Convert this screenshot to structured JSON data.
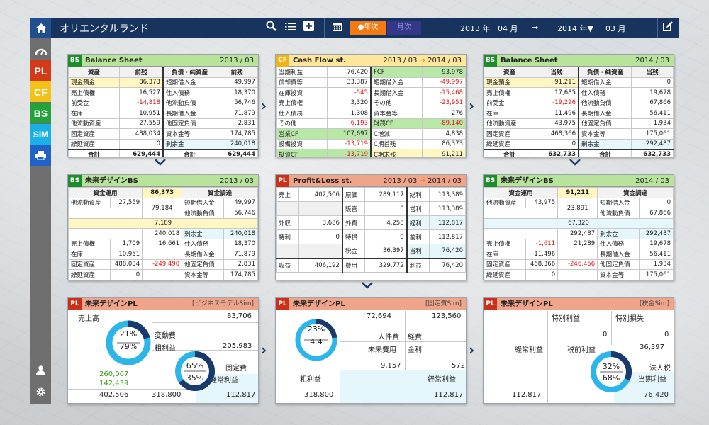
{
  "app": {
    "title": "オリエンタルランド"
  },
  "period": {
    "active": "●年次",
    "inactive": "月次",
    "from_year": "2013 年",
    "from_month": "04 月",
    "arrow": "→",
    "to_year": "2014 年▼",
    "to_month": "03 月"
  },
  "sidebar": {
    "pl": "PL",
    "cf": "CF",
    "bs": "BS",
    "sim": "SIM"
  },
  "colors": {
    "navy": "#17345e",
    "orange": "#f47a12",
    "pl": "#d23a1a",
    "cf": "#f3c21a",
    "bs": "#22a23a",
    "sim": "#1ab0e6",
    "donut_light": "#2cb5e8",
    "donut_dark": "#1a3a6b",
    "negative": "#e01414"
  },
  "bs1": {
    "tag": "BS",
    "title": "Balance Sheet",
    "date": "2013 / 03",
    "headers": [
      "資産",
      "前残",
      "負債・純資産",
      "前残"
    ],
    "rows": [
      [
        "現金預金",
        "86,373",
        "短期借入金",
        "49,997"
      ],
      [
        "売上債権",
        "16,527",
        "仕入債務",
        "18,370"
      ],
      [
        "前受金",
        "-14,818",
        "他流動負債",
        "56,746"
      ],
      [
        "在庫",
        "10,951",
        "長期借入金",
        "71,879"
      ],
      [
        "他流動資産",
        "27,559",
        "他固定負債",
        "2,831"
      ],
      [
        "固定資産",
        "488,034",
        "資本金等",
        "174,785"
      ],
      [
        "繰延資産",
        "0",
        "剰余金",
        "240,018"
      ]
    ],
    "total": [
      "合計",
      "629,444",
      "合計",
      "629,444"
    ]
  },
  "cf": {
    "tag": "CF",
    "title": "Cash Flow st.",
    "date_from": "2013 / 03",
    "date_to": "2014 / 03",
    "arrow": "→",
    "rows": [
      [
        "当期利益",
        "76,420",
        "FCF",
        "93,978"
      ],
      [
        "償却費等",
        "33,387",
        "短期借入金",
        "-49,997"
      ],
      [
        "在庫投資",
        "-545",
        "長期借入金",
        "-15,468"
      ],
      [
        "売上債権",
        "3,320",
        "その他",
        "-23,951"
      ],
      [
        "仕入債務",
        "1,308",
        "資本金等",
        "276"
      ],
      [
        "その他",
        "-6,193",
        "財務CF",
        "-89,140"
      ],
      [
        "営業CF",
        "107,697",
        "C増減",
        "4,838"
      ],
      [
        "設備投資",
        "-13,719",
        "C期首残",
        "86,373"
      ],
      [
        "投資CF",
        "-13,719",
        "C期末残",
        "91,211"
      ]
    ]
  },
  "bs2": {
    "tag": "BS",
    "title": "Balance Sheet",
    "date": "2014 / 03",
    "headers": [
      "資産",
      "当残",
      "負債・純資産",
      "当残"
    ],
    "rows": [
      [
        "現金預金",
        "91,211",
        "短期借入金",
        "0"
      ],
      [
        "売上債権",
        "17,685",
        "仕入債務",
        "19,678"
      ],
      [
        "前受金",
        "-19,296",
        "他流動負債",
        "67,866"
      ],
      [
        "在庫",
        "11,496",
        "長期借入金",
        "56,411"
      ],
      [
        "他流動資産",
        "43,975",
        "他固定負債",
        "1,934"
      ],
      [
        "固定資産",
        "468,366",
        "資本金等",
        "175,061"
      ],
      [
        "繰延資産",
        "0",
        "剰余金",
        "292,487"
      ]
    ],
    "total": [
      "合計",
      "632,733",
      "合計",
      "632,733"
    ]
  },
  "fbs1": {
    "tag": "BS",
    "title": "未来デザインBS",
    "date": "2013 / 03",
    "h1": "資金運用",
    "h2": "86,373",
    "h3": "資金調達",
    "r1": [
      "他流動資産",
      "27,559",
      "79,184",
      "短期借入金",
      "49,997"
    ],
    "r2": [
      "他流動負債",
      "56,746"
    ],
    "mid": "7,189",
    "r3": [
      "240,018",
      "剰余金",
      "240,018"
    ],
    "rows": [
      [
        "売上債権",
        "1,709",
        "16,661",
        "仕入債務",
        "18,370"
      ],
      [
        "在庫",
        "10,951",
        "",
        "長期借入金",
        "71,879"
      ],
      [
        "固定資産",
        "488,034",
        "-249,490",
        "他固定負債",
        "2,831"
      ],
      [
        "繰延資産",
        "0",
        "",
        "資本金等",
        "174,785"
      ]
    ]
  },
  "plst": {
    "tag": "PL",
    "title": "Profit&Loss st.",
    "date_from": "2013 / 03",
    "date_to": "2014 / 03",
    "arrow": "→",
    "rows": [
      [
        "売上",
        "402,506",
        "原価",
        "289,117",
        "総利",
        "113,389"
      ],
      [
        "",
        "",
        "販管",
        "0",
        "営利",
        "113,389"
      ],
      [
        "外収",
        "3,686",
        "外費",
        "4,258",
        "経利",
        "112,817"
      ],
      [
        "特利",
        "0",
        "特損",
        "0",
        "前利",
        "112,817"
      ],
      [
        "",
        "",
        "税金",
        "36,397",
        "当利",
        "76,420"
      ],
      [
        "収益",
        "406,192",
        "費用",
        "329,772",
        "利益",
        "76,420"
      ]
    ]
  },
  "fbs2": {
    "tag": "BS",
    "title": "未来デザインBS",
    "date": "2014 / 03",
    "h1": "資金運用",
    "h2": "91,211",
    "h3": "資金調達",
    "r1": [
      "他流動資産",
      "43,975",
      "23,891",
      "短期借入金",
      "0"
    ],
    "r2": [
      "他流動負債",
      "67,866"
    ],
    "mid": "67,320",
    "r3": [
      "292,487",
      "剰余金",
      "292,487"
    ],
    "rows": [
      [
        "売上債権",
        "-1,611",
        "21,289",
        "仕入債務",
        "19,678"
      ],
      [
        "在庫",
        "11,496",
        "",
        "長期借入金",
        "56,411"
      ],
      [
        "固定資産",
        "468,366",
        "-246,456",
        "他固定負債",
        "1,934"
      ],
      [
        "繰延資産",
        "0",
        "",
        "資本金等",
        "175,061"
      ]
    ]
  },
  "fpl1": {
    "tag": "PL",
    "title": "未来デザインPL",
    "sim": "[ビジネスモデルSim]",
    "sales_label": "売上高",
    "sales": "83,706",
    "var_cost_label": "変動費",
    "gross_label": "粗利益",
    "gross": "205,983",
    "pct1a": "21%",
    "pct1b": "79%",
    "pct2a": "65%",
    "pct2b": "35%",
    "fixed_label": "固定費",
    "op_label": "経常利益",
    "g1": "260,067",
    "g2": "142,439",
    "v1": "402,506",
    "v2": "318,800",
    "v3": "112,817",
    "donut1": 0.21,
    "donut2": 0.65
  },
  "fpl2": {
    "tag": "PL",
    "title": "未来デザインPL",
    "sim": "[固定費Sim]",
    "a": "72,694",
    "b": "123,560",
    "pct1": "23%",
    "pct2": "4.4",
    "labor_label": "人件費",
    "exp_label": "経費",
    "future_label": "未来費用",
    "interest_label": "金利",
    "c": "9,157",
    "d": "572",
    "gross_label": "粗利益",
    "op_label": "経常利益",
    "e": "318,800",
    "f": "112,817",
    "donut": 0.23
  },
  "fpl3": {
    "tag": "PL",
    "title": "未来デザインPL",
    "sim": "[税金Sim]",
    "sp_label": "特別利益",
    "sl_label": "特別損失",
    "sp": "0",
    "sl": "0",
    "op_label": "経常利益",
    "pre_label": "税前利益",
    "pre": "36,397",
    "tax_label": "法人税",
    "net_label": "当期利益",
    "pct1": "32%",
    "pct2": "68%",
    "v1": "112,817",
    "v2": "76,420",
    "donut": 0.32
  }
}
